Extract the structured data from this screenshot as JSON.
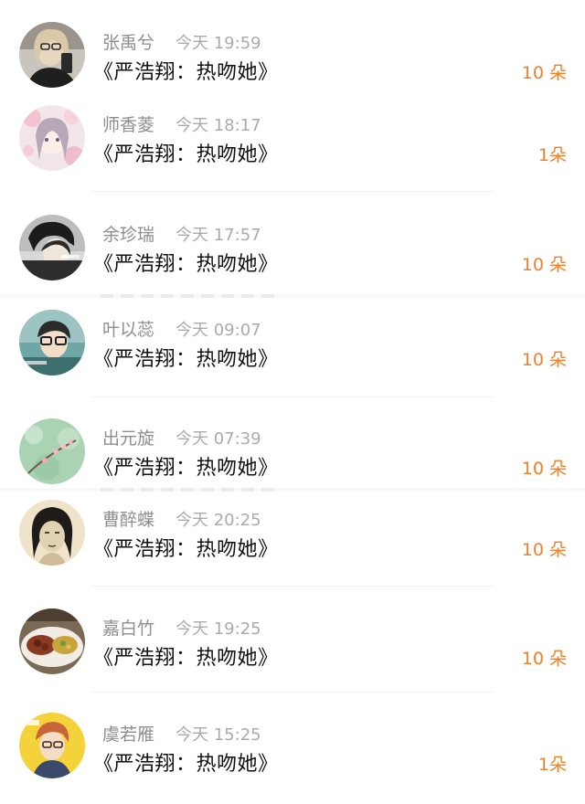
{
  "colors": {
    "gift_accent": "#f0802a",
    "name_text": "#8e8e8e",
    "time_text": "#ababab",
    "message_text": "#111111"
  },
  "items": [
    {
      "name": "张禹兮",
      "time": "今天 19:59",
      "message": "《严浩翔：热吻她》",
      "gift": "10 朵",
      "avatar_icon": "woman-selfie-avatar"
    },
    {
      "name": "师香菱",
      "time": "今天 18:17",
      "message": "《严浩翔：热吻她》",
      "gift": "1朵",
      "avatar_icon": "anime-girl-flowers-avatar"
    },
    {
      "name": "余珍瑞",
      "time": "今天 17:57",
      "message": "《严浩翔：热吻她》",
      "gift": "10 朵",
      "avatar_icon": "dark-hair-boy-avatar"
    },
    {
      "name": "叶以蕊",
      "time": "今天 09:07",
      "message": "《严浩翔：热吻她》",
      "gift": "10 朵",
      "avatar_icon": "glasses-boy-avatar"
    },
    {
      "name": "出元旋",
      "time": "今天 07:39",
      "message": "《严浩翔：热吻她》",
      "gift": "10 朵",
      "avatar_icon": "green-blossom-avatar"
    },
    {
      "name": "曹醉蝶",
      "time": "今天 20:25",
      "message": "《严浩翔：热吻她》",
      "gift": "10 朵",
      "avatar_icon": "sketch-portrait-avatar"
    },
    {
      "name": "嘉白竹",
      "time": "今天 19:25",
      "message": "《严浩翔：热吻她》",
      "gift": "10 朵",
      "avatar_icon": "food-plate-avatar"
    },
    {
      "name": "虞若雁",
      "time": "今天 15:25",
      "message": "《严浩翔：热吻她》",
      "gift": "1朵",
      "avatar_icon": "anime-boy-yellow-avatar"
    }
  ]
}
